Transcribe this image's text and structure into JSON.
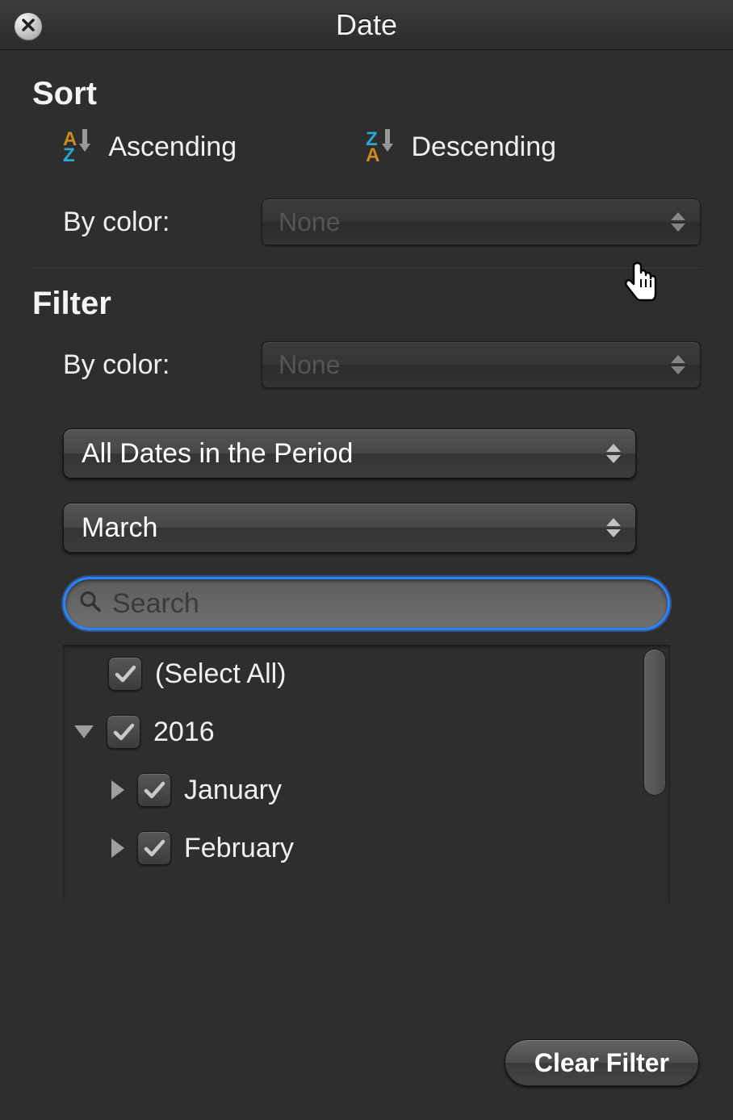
{
  "title": "Date",
  "sort": {
    "heading": "Sort",
    "ascending_label": "Ascending",
    "descending_label": "Descending",
    "by_color_label": "By color:",
    "by_color_value": "None"
  },
  "filter": {
    "heading": "Filter",
    "by_color_label": "By color:",
    "by_color_value": "None",
    "period_value": "All Dates in the Period",
    "month_value": "March",
    "search_placeholder": "Search"
  },
  "tree": {
    "select_all_label": "(Select All)",
    "year_label": "2016",
    "months": [
      "January",
      "February"
    ]
  },
  "clear_filter_label": "Clear Filter"
}
